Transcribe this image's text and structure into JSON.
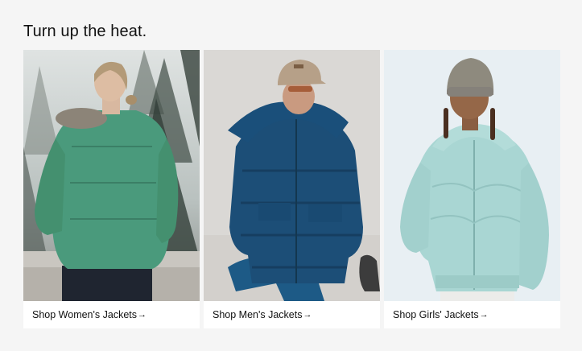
{
  "section": {
    "heading": "Turn up the heat."
  },
  "cards": [
    {
      "label": "Shop Women's Jackets",
      "image": "woman-in-green-down-jacket-forest"
    },
    {
      "label": "Shop Men's Jackets",
      "image": "man-in-blue-puffer-jacket"
    },
    {
      "label": "Shop Girls' Jackets",
      "image": "girl-in-mint-fleece-jacket"
    }
  ],
  "arrow_glyph": "→"
}
